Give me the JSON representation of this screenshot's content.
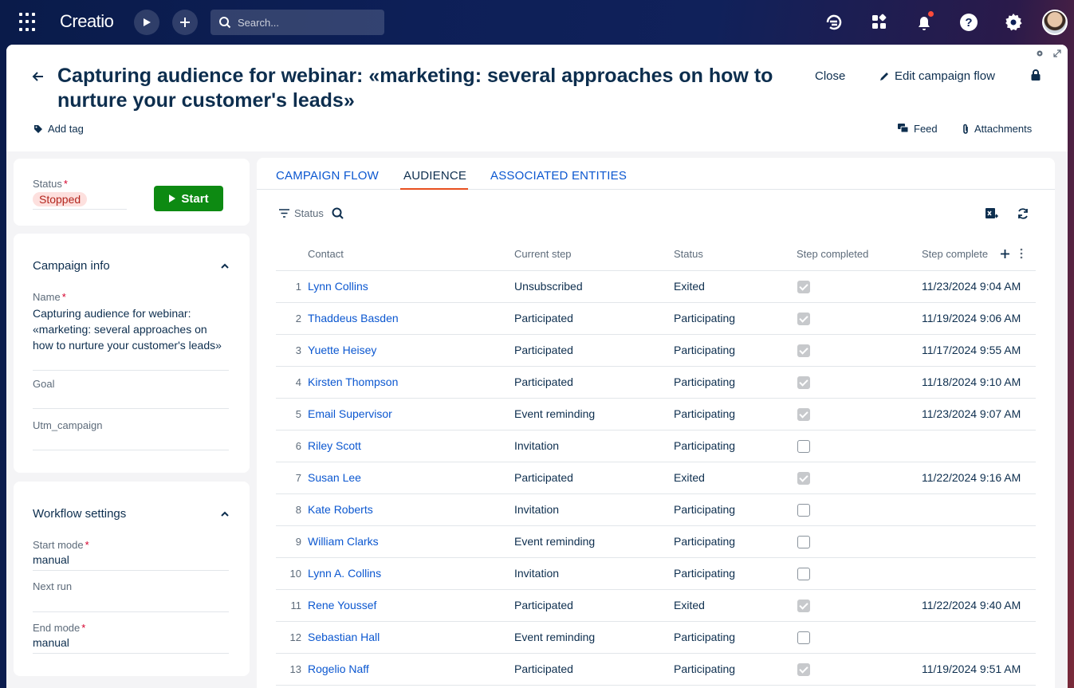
{
  "topbar": {
    "logo": "Creatio",
    "search_placeholder": "Search..."
  },
  "header": {
    "title": "Capturing audience for webinar: «marketing: several approaches on how to nurture your customer's leads»",
    "close_label": "Close",
    "edit_flow_label": "Edit campaign flow",
    "add_tag_label": "Add tag",
    "feed_label": "Feed",
    "attachments_label": "Attachments"
  },
  "status_panel": {
    "status_label": "Status",
    "status_value": "Stopped",
    "start_label": "Start"
  },
  "campaign_info": {
    "title": "Campaign info",
    "name_label": "Name",
    "name_value": "Capturing audience for webinar: «marketing: several approaches on how to nurture your customer's leads»",
    "goal_label": "Goal",
    "goal_value": "",
    "utm_label": "Utm_campaign",
    "utm_value": ""
  },
  "workflow_settings": {
    "title": "Workflow settings",
    "start_mode_label": "Start mode",
    "start_mode_value": "manual",
    "next_run_label": "Next run",
    "next_run_value": "",
    "end_mode_label": "End mode",
    "end_mode_value": "manual"
  },
  "tabs": [
    {
      "label": "CAMPAIGN FLOW"
    },
    {
      "label": "AUDIENCE"
    },
    {
      "label": "ASSOCIATED ENTITIES"
    }
  ],
  "filter": {
    "status_label": "Status"
  },
  "table": {
    "columns": [
      "Contact",
      "Current step",
      "Status",
      "Step completed",
      "Step complete"
    ],
    "rows": [
      {
        "num": "1",
        "contact": "Lynn Collins",
        "step": "Unsubscribed",
        "status": "Exited",
        "completed": true,
        "date": "11/23/2024 9:04 AM"
      },
      {
        "num": "2",
        "contact": "Thaddeus Basden",
        "step": "Participated",
        "status": "Participating",
        "completed": true,
        "date": "11/19/2024 9:06 AM"
      },
      {
        "num": "3",
        "contact": "Yuette Heisey",
        "step": "Participated",
        "status": "Participating",
        "completed": true,
        "date": "11/17/2024 9:55 AM"
      },
      {
        "num": "4",
        "contact": "Kirsten Thompson",
        "step": "Participated",
        "status": "Participating",
        "completed": true,
        "date": "11/18/2024 9:10 AM"
      },
      {
        "num": "5",
        "contact": "Email Supervisor",
        "step": "Event reminding",
        "status": "Participating",
        "completed": true,
        "date": "11/23/2024 9:07 AM"
      },
      {
        "num": "6",
        "contact": "Riley Scott",
        "step": "Invitation",
        "status": "Participating",
        "completed": false,
        "date": ""
      },
      {
        "num": "7",
        "contact": "Susan Lee",
        "step": "Participated",
        "status": "Exited",
        "completed": true,
        "date": "11/22/2024 9:16 AM"
      },
      {
        "num": "8",
        "contact": "Kate Roberts",
        "step": "Invitation",
        "status": "Participating",
        "completed": false,
        "date": ""
      },
      {
        "num": "9",
        "contact": "William Clarks",
        "step": "Event reminding",
        "status": "Participating",
        "completed": false,
        "date": ""
      },
      {
        "num": "10",
        "contact": "Lynn A. Collins",
        "step": "Invitation",
        "status": "Participating",
        "completed": false,
        "date": ""
      },
      {
        "num": "11",
        "contact": "Rene Youssef",
        "step": "Participated",
        "status": "Exited",
        "completed": true,
        "date": "11/22/2024 9:40 AM"
      },
      {
        "num": "12",
        "contact": "Sebastian Hall",
        "step": "Event reminding",
        "status": "Participating",
        "completed": false,
        "date": ""
      },
      {
        "num": "13",
        "contact": "Rogelio Naff",
        "step": "Participated",
        "status": "Participating",
        "completed": true,
        "date": "11/19/2024 9:51 AM"
      }
    ]
  },
  "colors": {
    "accent": "#0b57d0",
    "start_button": "#0d8a12",
    "stopped_badge_bg": "#fde0de",
    "tab_underline": "#e8501f"
  }
}
